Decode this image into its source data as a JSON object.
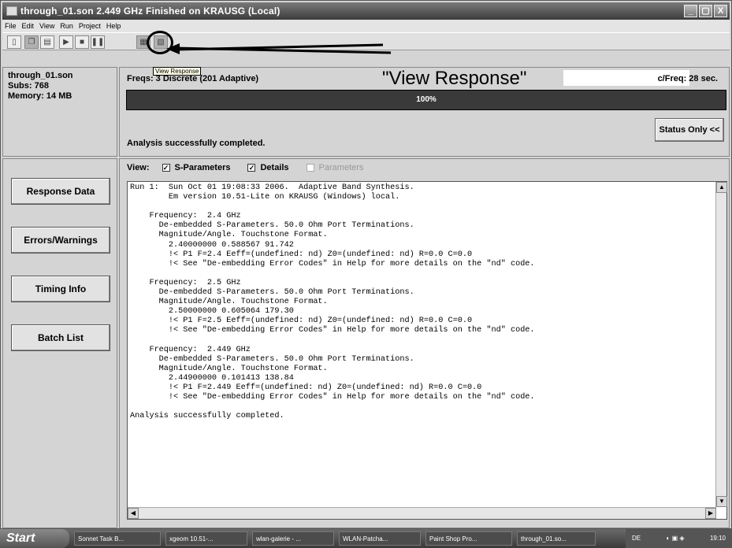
{
  "window": {
    "title": "through_01.son  2.449 GHz Finished on KRAUSG (Local)",
    "controls": [
      "_",
      "▢",
      "X"
    ]
  },
  "menu": [
    "File",
    "Edit",
    "View",
    "Run",
    "Project",
    "Help"
  ],
  "toolbar": {
    "tooltip": "View Response"
  },
  "annotation": {
    "view_response": "\"View Response\""
  },
  "info": {
    "file": "through_01.son",
    "subs": "Subs: 768",
    "memory": "Memory: 14 MB"
  },
  "status": {
    "freq_label": "Freqs: 3 Discrete (201 Adaptive)",
    "cfreq_label": "c/Freq: 28 sec.",
    "progress_text": "100%",
    "progress_value": 1.0,
    "message": "Analysis successfully completed.",
    "status_only_button": "Status Only <<"
  },
  "sidebar": {
    "buttons": [
      "Response Data",
      "Errors/Warnings",
      "Timing Info",
      "Batch List"
    ]
  },
  "view_options": {
    "label": "View:",
    "checkboxes": [
      {
        "label": "S-Parameters",
        "checked": true,
        "enabled": true
      },
      {
        "label": "Details",
        "checked": true,
        "enabled": true
      },
      {
        "label": "Parameters",
        "checked": false,
        "enabled": false
      }
    ]
  },
  "output_lines": [
    "Run 1:  Sun Oct 01 19:08:33 2006.  Adaptive Band Synthesis.",
    "        Em version 10.51-Lite on KRAUSG (Windows) local.",
    "",
    "    Frequency:  2.4 GHz",
    "      De-embedded S-Parameters. 50.0 Ohm Port Terminations.",
    "      Magnitude/Angle. Touchstone Format.",
    "        2.40000000 0.588567 91.742",
    "        !< P1 F=2.4 Eeff=(undefined: nd) Z0=(undefined: nd) R=0.0 C=0.0",
    "        !< See \"De-embedding Error Codes\" in Help for more details on the \"nd\" code.",
    "",
    "    Frequency:  2.5 GHz",
    "      De-embedded S-Parameters. 50.0 Ohm Port Terminations.",
    "      Magnitude/Angle. Touchstone Format.",
    "        2.50000000 0.605064 179.30",
    "        !< P1 F=2.5 Eeff=(undefined: nd) Z0=(undefined: nd) R=0.0 C=0.0",
    "        !< See \"De-embedding Error Codes\" in Help for more details on the \"nd\" code.",
    "",
    "    Frequency:  2.449 GHz",
    "      De-embedded S-Parameters. 50.0 Ohm Port Terminations.",
    "      Magnitude/Angle. Touchstone Format.",
    "        2.44900000 0.101413 138.84",
    "        !< P1 F=2.449 Eeff=(undefined: nd) Z0=(undefined: nd) R=0.0 C=0.0",
    "        !< See \"De-embedding Error Codes\" in Help for more details on the \"nd\" code.",
    "",
    "Analysis successfully completed."
  ],
  "taskbar": {
    "start": "Start",
    "items": [
      "Sonnet Task B...",
      "xgeom 10.51-...",
      "wlan-galerie - ...",
      "WLAN-Patcha...",
      "Paint Shop Pro...",
      "through_01.so..."
    ],
    "tray_lang": "DE",
    "clock": "19:10"
  }
}
